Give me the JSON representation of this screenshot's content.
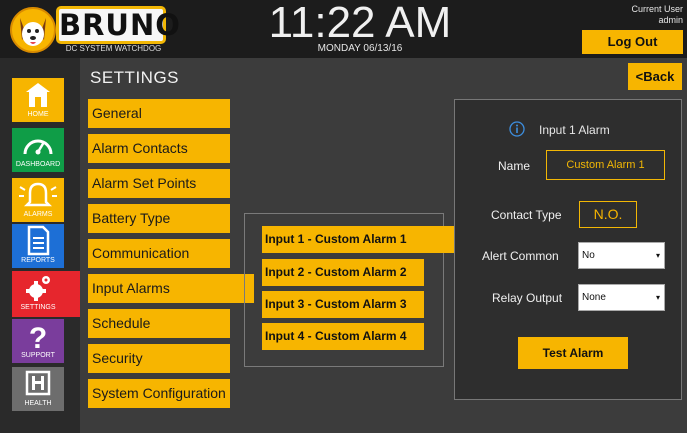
{
  "header": {
    "brand": "BRUNO",
    "brand_subtitle": "DC SYSTEM WATCHDOG",
    "time": "11:22 AM",
    "date": "MONDAY 06/13/16",
    "user_label": "Current User",
    "user_name": "admin",
    "logout_label": "Log Out"
  },
  "sidebar": {
    "items": [
      {
        "label": "HOME",
        "icon": "home-icon"
      },
      {
        "label": "DASHBOARD",
        "icon": "gauge-icon"
      },
      {
        "label": "ALARMS",
        "icon": "bell-icon"
      },
      {
        "label": "REPORTS",
        "icon": "document-icon"
      },
      {
        "label": "SETTINGS",
        "icon": "gear-icon"
      },
      {
        "label": "SUPPORT",
        "icon": "question-icon"
      },
      {
        "label": "HEALTH",
        "icon": "health-icon"
      }
    ],
    "active": "SETTINGS"
  },
  "page": {
    "title": "SETTINGS",
    "back_label": "<Back"
  },
  "menu": {
    "items": [
      "General",
      "Alarm Contacts",
      "Alarm Set Points",
      "Battery Type",
      "Communication",
      "Input Alarms",
      "Schedule",
      "Security",
      "System Configuration"
    ],
    "selected": "Input Alarms"
  },
  "inputs": {
    "items": [
      "Input 1 - Custom Alarm 1",
      "Input 2 - Custom Alarm 2",
      "Input 3 - Custom Alarm 3",
      "Input 4 - Custom Alarm 4"
    ],
    "selected": "Input 1 - Custom Alarm 1"
  },
  "detail": {
    "title": "Input 1 Alarm",
    "name_label": "Name",
    "name_value": "Custom Alarm 1",
    "contact_type_label": "Contact Type",
    "contact_type_value": "N.O.",
    "alert_common_label": "Alert Common",
    "alert_common_value": "No",
    "relay_output_label": "Relay Output",
    "relay_output_value": "None",
    "test_button_label": "Test Alarm"
  },
  "colors": {
    "accent": "#f7b500",
    "header_bg": "#1c1c1c",
    "content_bg": "#3c3c3c",
    "settings_red": "#e6262d",
    "dashboard_green": "#0f9d47",
    "reports_blue": "#1d6fd6",
    "support_purple": "#7a3d9c"
  }
}
